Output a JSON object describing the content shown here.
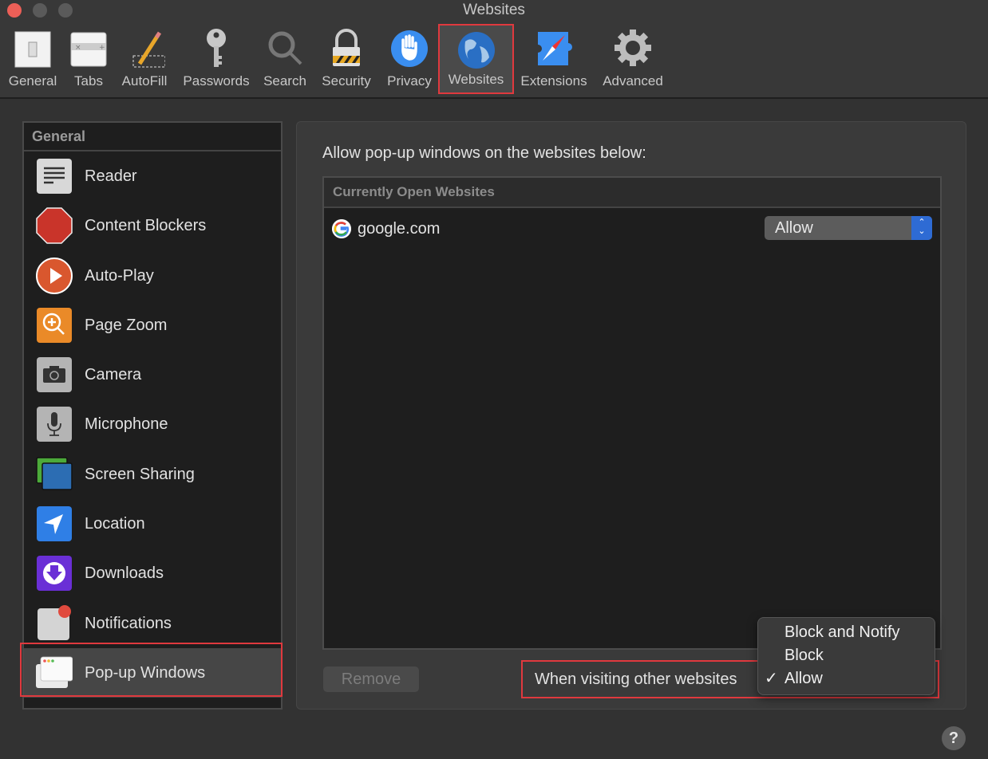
{
  "window": {
    "title": "Websites"
  },
  "toolbar": {
    "items": [
      {
        "label": "General",
        "icon": "switch-icon"
      },
      {
        "label": "Tabs",
        "icon": "tabs-icon"
      },
      {
        "label": "AutoFill",
        "icon": "pencil-icon"
      },
      {
        "label": "Passwords",
        "icon": "key-icon"
      },
      {
        "label": "Search",
        "icon": "magnifier-icon"
      },
      {
        "label": "Security",
        "icon": "lock-icon"
      },
      {
        "label": "Privacy",
        "icon": "hand-icon"
      },
      {
        "label": "Websites",
        "icon": "globe-icon",
        "selected": true
      },
      {
        "label": "Extensions",
        "icon": "puzzle-compass-icon"
      },
      {
        "label": "Advanced",
        "icon": "gear-icon"
      }
    ]
  },
  "sidebar": {
    "header": "General",
    "items": [
      {
        "label": "Reader",
        "icon": "reader-icon"
      },
      {
        "label": "Content Blockers",
        "icon": "stop-sign-icon"
      },
      {
        "label": "Auto-Play",
        "icon": "play-icon"
      },
      {
        "label": "Page Zoom",
        "icon": "zoom-icon"
      },
      {
        "label": "Camera",
        "icon": "camera-icon"
      },
      {
        "label": "Microphone",
        "icon": "microphone-icon"
      },
      {
        "label": "Screen Sharing",
        "icon": "screen-sharing-icon"
      },
      {
        "label": "Location",
        "icon": "location-arrow-icon"
      },
      {
        "label": "Downloads",
        "icon": "download-icon"
      },
      {
        "label": "Notifications",
        "icon": "notification-badge-icon"
      },
      {
        "label": "Pop-up Windows",
        "icon": "popup-windows-icon",
        "selected": true
      }
    ]
  },
  "main": {
    "title": "Allow pop-up windows on the websites below:",
    "table": {
      "header": "Currently Open Websites",
      "rows": [
        {
          "site": "google.com",
          "setting": "Allow"
        }
      ]
    },
    "remove_label": "Remove",
    "other_websites_label": "When visiting other websites",
    "menu": {
      "options": [
        "Block and Notify",
        "Block",
        "Allow"
      ],
      "checked": "Allow",
      "check_glyph": "✓"
    }
  },
  "help": {
    "label": "?"
  },
  "colors": {
    "highlight": "#e0393e",
    "accent": "#2e6bd4"
  }
}
